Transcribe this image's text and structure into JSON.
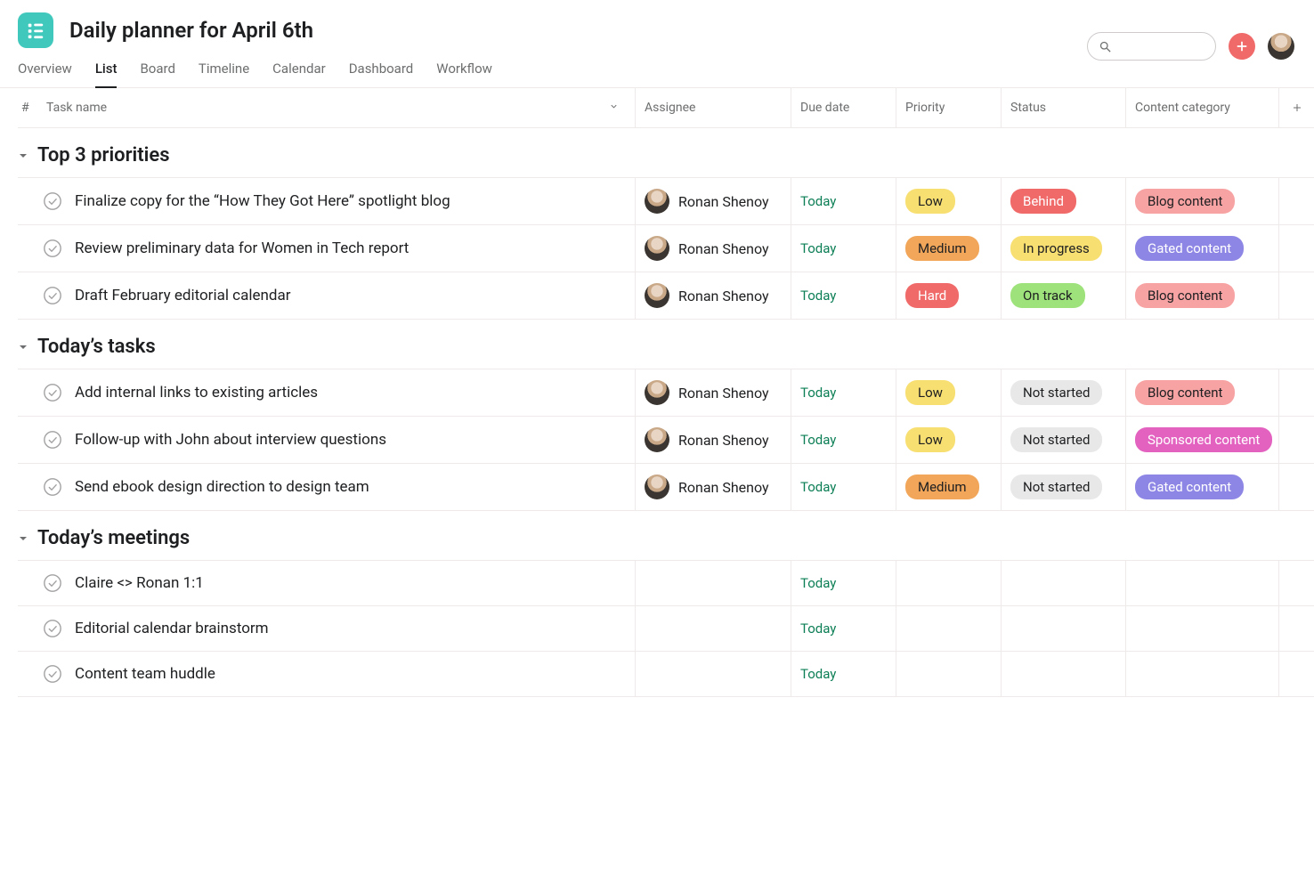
{
  "project": {
    "title": "Daily planner for April 6th"
  },
  "tabs": {
    "items": [
      "Overview",
      "List",
      "Board",
      "Timeline",
      "Calendar",
      "Dashboard",
      "Workflow"
    ],
    "active_index": 1
  },
  "columns": {
    "hash": "#",
    "task": "Task name",
    "assignee": "Assignee",
    "due": "Due date",
    "priority": "Priority",
    "status": "Status",
    "category": "Content category"
  },
  "sections": [
    {
      "title": "Top 3 priorities",
      "rows": [
        {
          "name": "Finalize copy for the “How They Got Here” spotlight blog",
          "assignee": "Ronan Shenoy",
          "due": "Today",
          "priority": {
            "label": "Low",
            "style": "yellow"
          },
          "status": {
            "label": "Behind",
            "style": "redsoft"
          },
          "category": {
            "label": "Blog content",
            "style": "salmon"
          }
        },
        {
          "name": "Review preliminary data for Women in Tech report",
          "assignee": "Ronan Shenoy",
          "due": "Today",
          "priority": {
            "label": "Medium",
            "style": "orange"
          },
          "status": {
            "label": "In progress",
            "style": "yellow"
          },
          "category": {
            "label": "Gated content",
            "style": "purple"
          }
        },
        {
          "name": "Draft February editorial calendar",
          "assignee": "Ronan Shenoy",
          "due": "Today",
          "priority": {
            "label": "Hard",
            "style": "red"
          },
          "status": {
            "label": "On track",
            "style": "green"
          },
          "category": {
            "label": "Blog content",
            "style": "salmon"
          }
        }
      ]
    },
    {
      "title": "Today’s tasks",
      "rows": [
        {
          "name": "Add internal links to existing articles",
          "assignee": "Ronan Shenoy",
          "due": "Today",
          "priority": {
            "label": "Low",
            "style": "yellow"
          },
          "status": {
            "label": "Not started",
            "style": "grey"
          },
          "category": {
            "label": "Blog content",
            "style": "salmon"
          }
        },
        {
          "name": "Follow-up with John about interview questions",
          "assignee": "Ronan Shenoy",
          "due": "Today",
          "priority": {
            "label": "Low",
            "style": "yellow"
          },
          "status": {
            "label": "Not started",
            "style": "grey"
          },
          "category": {
            "label": "Sponsored content",
            "style": "magenta"
          }
        },
        {
          "name": "Send ebook design direction to design team",
          "assignee": "Ronan Shenoy",
          "due": "Today",
          "priority": {
            "label": "Medium",
            "style": "orange"
          },
          "status": {
            "label": "Not started",
            "style": "grey"
          },
          "category": {
            "label": "Gated content",
            "style": "purple"
          }
        }
      ]
    },
    {
      "title": "Today’s meetings",
      "rows": [
        {
          "name": "Claire <> Ronan 1:1",
          "assignee": null,
          "due": "Today",
          "priority": null,
          "status": null,
          "category": null
        },
        {
          "name": "Editorial calendar brainstorm",
          "assignee": null,
          "due": "Today",
          "priority": null,
          "status": null,
          "category": null
        },
        {
          "name": "Content team huddle",
          "assignee": null,
          "due": "Today",
          "priority": null,
          "status": null,
          "category": null
        }
      ]
    }
  ]
}
